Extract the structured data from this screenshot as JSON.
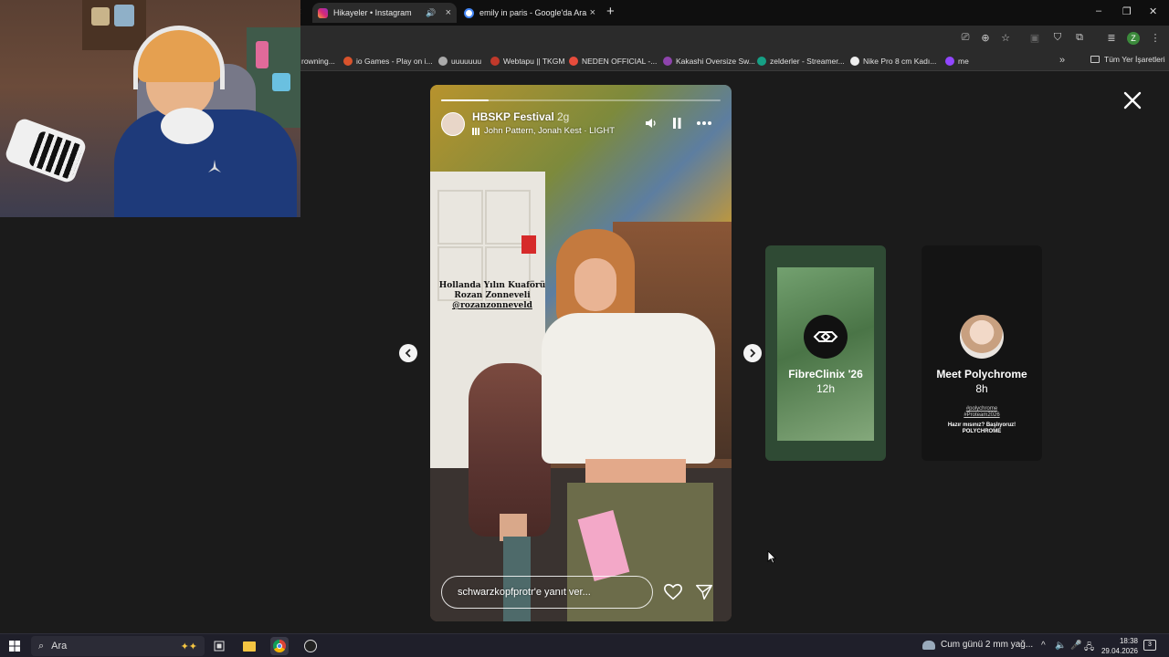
{
  "browser": {
    "tabs": [
      {
        "title": "Hikayeler • Instagram",
        "active": true
      },
      {
        "title": "emily in paris - Google'da Ara",
        "active": false
      }
    ],
    "bookmarks": [
      {
        "label": "rowning...",
        "color": "#888888"
      },
      {
        "label": "io Games - Play on i...",
        "color": "#d9532c"
      },
      {
        "label": "uuuuuuu",
        "color": "#aaaaaa"
      },
      {
        "label": "Webtapu || TKGM",
        "color": "#c0392b"
      },
      {
        "label": "NEDEN OFFICIAL -...",
        "color": "#e74c3c"
      },
      {
        "label": "Kakashi Oversize Sw...",
        "color": "#8e44ad"
      },
      {
        "label": "zelderler - Streamer...",
        "color": "#16a085"
      },
      {
        "label": "Nike Pro 8 cm Kadı...",
        "color": "#eeeeee"
      },
      {
        "label": "me",
        "color": "#9146ff"
      }
    ],
    "all_bookmarks_label": "Tüm Yer İşaretleri",
    "profile_initial": "Z"
  },
  "story": {
    "username": "HBSKP Festival",
    "age": "2g",
    "music": "John Pattern, Jonah Kest · LIGHT",
    "overlay_lines": [
      "Hollanda Yılın Kuaförü",
      "Rozan Zonneveli",
      "@rozanzonneveld"
    ],
    "reply_placeholder": "schwarzkopfprotr'e yanıt ver...",
    "progress": 0.17
  },
  "next_stories": [
    {
      "name": "FibreClinix '26",
      "time": "12h",
      "bg": "#2f4a34"
    },
    {
      "name": "Meet Polychrome",
      "time": "8h",
      "bg": "#141414",
      "tags": [
        "#polychrome",
        "#Proteam2026"
      ],
      "caption": [
        "Hazır mısınız? Başlıyoruz!",
        "POLYCHROME"
      ]
    }
  ],
  "taskbar": {
    "search_label": "Ara",
    "weather": "Cum günü 2 mm yağ...",
    "time": "18:38",
    "date": "29.04.2026",
    "notifications": "3"
  },
  "colors": {
    "background": "#1b1b1b",
    "chrome": "#2b2b2b",
    "taskbar": "#1f1f2a"
  }
}
